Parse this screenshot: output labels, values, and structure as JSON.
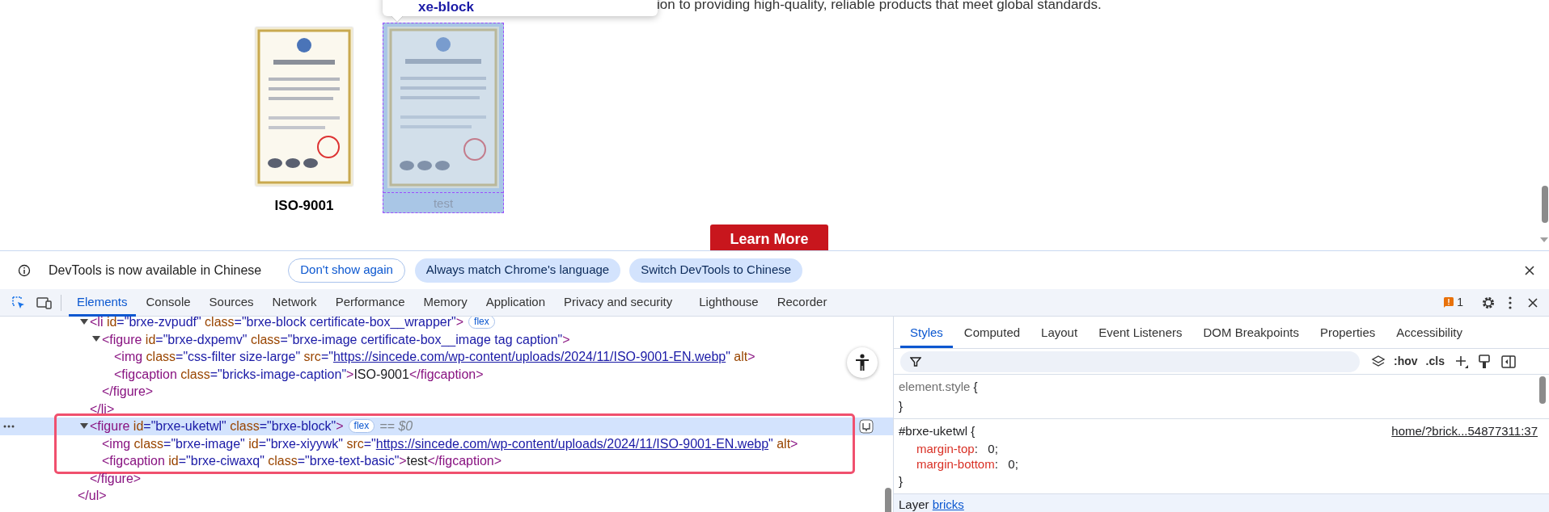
{
  "page": {
    "tooltip": "xe-block",
    "intro_text": "ion to providing high-quality, reliable products that meet global standards.",
    "certificates": [
      {
        "caption": "ISO-9001",
        "inspected": false
      },
      {
        "caption": "test",
        "inspected": true
      }
    ],
    "button": "Learn More"
  },
  "infobar": {
    "message": "DevTools is now available in Chinese",
    "buttons": [
      {
        "label": "Don't show again",
        "kind": "outlined"
      },
      {
        "label": "Always match Chrome's language",
        "kind": "filled"
      },
      {
        "label": "Switch DevTools to Chinese",
        "kind": "filled"
      }
    ]
  },
  "tabs": [
    {
      "label": "Elements",
      "selected": true
    },
    {
      "label": "Console",
      "selected": false
    },
    {
      "label": "Sources",
      "selected": false
    },
    {
      "label": "Network",
      "selected": false
    },
    {
      "label": "Performance",
      "selected": false
    },
    {
      "label": "Memory",
      "selected": false
    },
    {
      "label": "Application",
      "selected": false
    },
    {
      "label": "Privacy and security",
      "selected": false
    },
    {
      "label": "Lighthouse",
      "selected": false
    },
    {
      "label": "Recorder",
      "selected": false
    }
  ],
  "issues_count": "1",
  "elements_tree": {
    "children": [
      {
        "expanded": true,
        "selected": false,
        "open": [
          {
            "kind": "tag",
            "text": "<li"
          },
          {
            "kind": "attr",
            "text": " id"
          },
          {
            "kind": "value",
            "text": "=\"brxe-zvpudf\""
          },
          {
            "kind": "attr",
            "text": " class"
          },
          {
            "kind": "value",
            "text": "=\"brxe-block certificate-box__wrapper\""
          },
          {
            "kind": "tag",
            "text": ">"
          }
        ],
        "badges": [
          "flex"
        ],
        "children": [
          {
            "expanded": true,
            "selected": false,
            "open": [
              {
                "kind": "tag",
                "text": "<figure"
              },
              {
                "kind": "attr",
                "text": " id"
              },
              {
                "kind": "value",
                "text": "=\"brxe-dxpemv\""
              },
              {
                "kind": "attr",
                "text": " class"
              },
              {
                "kind": "value",
                "text": "=\"brxe-image certificate-box__image tag caption\""
              },
              {
                "kind": "tag",
                "text": ">"
              }
            ],
            "children": [
              {
                "selected": false,
                "open": [
                  {
                    "kind": "tag",
                    "text": "<img"
                  },
                  {
                    "kind": "attr",
                    "text": " class"
                  },
                  {
                    "kind": "value",
                    "text": "=\"css-filter size-large\""
                  },
                  {
                    "kind": "attr",
                    "text": " src"
                  },
                  {
                    "kind": "value",
                    "text": "=\""
                  },
                  {
                    "kind": "link",
                    "text": "https://sincede.com/wp-content/uploads/2024/11/ISO-9001-EN.webp"
                  },
                  {
                    "kind": "value",
                    "text": "\""
                  },
                  {
                    "kind": "attr",
                    "text": " alt"
                  },
                  {
                    "kind": "tag",
                    "text": ">"
                  }
                ]
              },
              {
                "selected": false,
                "open": [
                  {
                    "kind": "tag",
                    "text": "<figcaption"
                  },
                  {
                    "kind": "attr",
                    "text": " class"
                  },
                  {
                    "kind": "value",
                    "text": "=\"bricks-image-caption\""
                  },
                  {
                    "kind": "tag",
                    "text": ">"
                  },
                  {
                    "kind": "text",
                    "text": "ISO-9001"
                  },
                  {
                    "kind": "tag",
                    "text": "</figcaption>"
                  }
                ]
              }
            ],
            "close": [
              {
                "kind": "tag",
                "text": "</figure>"
              }
            ]
          }
        ],
        "close": [
          {
            "kind": "tag",
            "text": "</li>"
          }
        ]
      },
      {
        "expanded": true,
        "selected": true,
        "annotated": true,
        "open": [
          {
            "kind": "tag",
            "text": "<figure"
          },
          {
            "kind": "attr",
            "text": " id"
          },
          {
            "kind": "value",
            "text": "=\"brxe-uketwl\""
          },
          {
            "kind": "attr",
            "text": " class"
          },
          {
            "kind": "value",
            "text": "=\"brxe-block\""
          },
          {
            "kind": "tag",
            "text": ">"
          }
        ],
        "badges": [
          "flex"
        ],
        "hint": "== $0",
        "children": [
          {
            "selected": false,
            "open": [
              {
                "kind": "tag",
                "text": "<img"
              },
              {
                "kind": "attr",
                "text": " class"
              },
              {
                "kind": "value",
                "text": "=\"brxe-image\""
              },
              {
                "kind": "attr",
                "text": " id"
              },
              {
                "kind": "value",
                "text": "=\"brxe-xiyywk\""
              },
              {
                "kind": "attr",
                "text": " src"
              },
              {
                "kind": "value",
                "text": "=\""
              },
              {
                "kind": "link",
                "text": "https://sincede.com/wp-content/uploads/2024/11/ISO-9001-EN.webp"
              },
              {
                "kind": "value",
                "text": "\""
              },
              {
                "kind": "attr",
                "text": " alt"
              },
              {
                "kind": "tag",
                "text": ">"
              }
            ]
          },
          {
            "selected": false,
            "open": [
              {
                "kind": "tag",
                "text": "<figcaption"
              },
              {
                "kind": "attr",
                "text": " id"
              },
              {
                "kind": "value",
                "text": "=\"brxe-ciwaxq\""
              },
              {
                "kind": "attr",
                "text": " class"
              },
              {
                "kind": "value",
                "text": "=\"brxe-text-basic\""
              },
              {
                "kind": "tag",
                "text": ">"
              },
              {
                "kind": "text",
                "text": "test"
              },
              {
                "kind": "tag",
                "text": "</figcaption>"
              }
            ]
          }
        ],
        "close": [
          {
            "kind": "tag",
            "text": "</figure>"
          }
        ]
      }
    ],
    "close": [
      {
        "kind": "tag",
        "text": "</ul>"
      }
    ]
  },
  "styles_panel": {
    "tabs": [
      {
        "label": "Styles",
        "selected": true
      },
      {
        "label": "Computed",
        "selected": false
      },
      {
        "label": "Layout",
        "selected": false
      },
      {
        "label": "Event Listeners",
        "selected": false
      },
      {
        "label": "DOM Breakpoints",
        "selected": false
      },
      {
        "label": "Properties",
        "selected": false
      },
      {
        "label": "Accessibility",
        "selected": false
      }
    ],
    "toolbar_buttons": [
      ":hov",
      ".cls"
    ],
    "rules": [
      {
        "kind": "inline",
        "selector": "element.style",
        "open_brace": "{",
        "close_brace": "}"
      },
      {
        "kind": "rule",
        "selector": "#brxe-uketwl",
        "open_brace": "{",
        "close_brace": "}",
        "source": "home/?brick...54877311:37",
        "declarations": [
          {
            "property": "margin-top",
            "colon": ":",
            "value": "0;"
          },
          {
            "property": "margin-bottom",
            "colon": ":",
            "value": "0;"
          }
        ]
      }
    ],
    "layer": {
      "label": "Layer",
      "link": "bricks"
    }
  }
}
